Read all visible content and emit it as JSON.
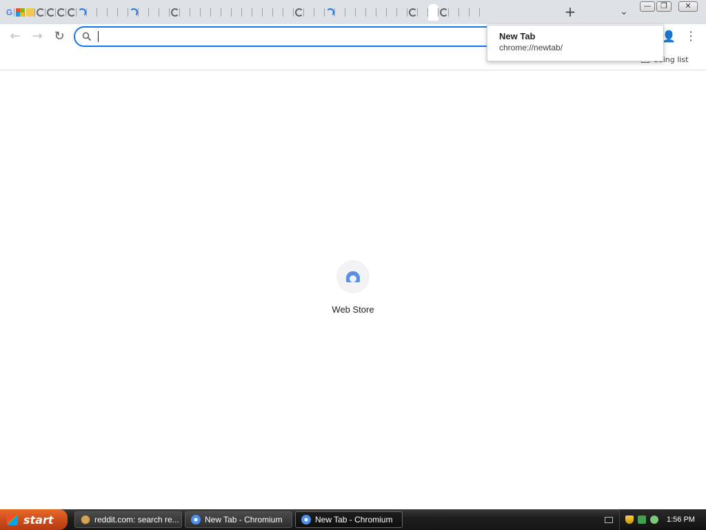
{
  "window": {
    "tabs": [
      {
        "favicon": "google-icon",
        "glyph": "G"
      },
      {
        "favicon": "microsoft-icon",
        "glyph": ""
      },
      {
        "favicon": "bookmark-icon",
        "glyph": ""
      },
      {
        "favicon": "chromium-swirl-icon",
        "glyph": ""
      },
      {
        "favicon": "chromium-swirl-icon",
        "glyph": ""
      },
      {
        "favicon": "chromium-swirl-icon",
        "glyph": ""
      },
      {
        "favicon": "chromium-swirl-icon",
        "glyph": ""
      },
      {
        "favicon": "loading-spinner-icon",
        "glyph": ""
      }
    ],
    "new_tab_label": "+",
    "tab_search_label": "⌄",
    "minimize_label": "—",
    "maximize_label": "❐",
    "close_label": "✕"
  },
  "toolbar": {
    "back_icon": "←",
    "forward_icon": "→",
    "reload_icon": "↻",
    "omnibox_value": "",
    "omnibox_icon": "search-icon",
    "profile_icon": "👤",
    "menu_icon": "⋮"
  },
  "bookmarks": {
    "reading_list_label": "ading list"
  },
  "tooltip": {
    "title": "New Tab",
    "url": "chrome://newtab/"
  },
  "page": {
    "shortcut_label": "Web Store"
  },
  "taskbar": {
    "start_label": "start",
    "tasks": [
      {
        "label": "reddit.com: search re...",
        "icon": "reddit-icon"
      },
      {
        "label": "New Tab - Chromium",
        "icon": "chromium-icon"
      },
      {
        "label": "New Tab - Chromium",
        "icon": "chromium-icon"
      }
    ],
    "clock": "1:56 PM"
  },
  "colors": {
    "accent": "#1a73e8",
    "tabstrip": "#dee1e6",
    "taskbar": "#1e1e1e",
    "start": "#c9491a"
  }
}
